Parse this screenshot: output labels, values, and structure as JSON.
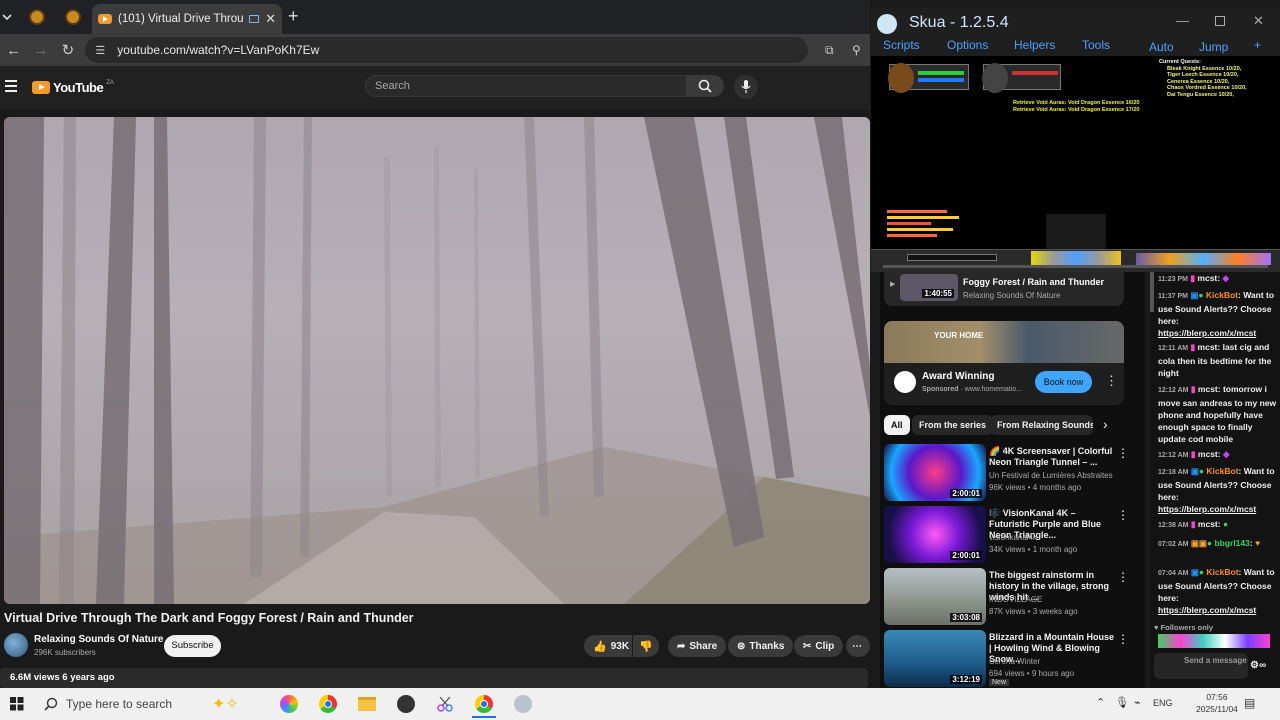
{
  "browser": {
    "tab_title": "(101) Virtual Drive Through",
    "url": "youtube.com/watch?v=LVanPoKh7Ew"
  },
  "youtube": {
    "logo": "YouTube",
    "region": "ZA",
    "search_placeholder": "Search",
    "video_title": "Virtual Drive Through The Dark and Foggy Forest / Rain and Thunder",
    "channel_name": "Relaxing Sounds Of Nature",
    "subscribers": "296K subscribers",
    "subscribe_label": "Subscribe",
    "likes": "93K",
    "share_label": "Share",
    "thanks_label": "Thanks",
    "clip_label": "Clip",
    "views_age": "6.6M views  6 years ago",
    "playlist_item": {
      "title": "Foggy Forest / Rain and Thunder",
      "channel": "Relaxing Sounds Of Nature",
      "duration": "1:40:55"
    },
    "ad": {
      "banner_line1": "YOUR HOME",
      "title": "Award Winning",
      "sponsor": "Sponsored",
      "url": "www.homematio...",
      "cta": "Book now"
    },
    "chips": [
      "All",
      "From the series",
      "From Relaxing Sounds Of"
    ],
    "recommendations": [
      {
        "title": "🌈 4K Screensaver | Colorful Neon Triangle Tunnel – ...",
        "channel": "Un Festival de Lumières Abstraites",
        "meta": "96K views • 4 months ago",
        "duration": "2:00:01"
      },
      {
        "title": "🎼 VisionKanal 4K – Futuristic Purple and Blue Neon Triangle...",
        "channel": "visionkanal4k",
        "meta": "34K views • 1 month ago",
        "duration": "2:00:01"
      },
      {
        "title": "The biggest rainstorm in history in the village, strong winds hit ...",
        "channel": "INDOVILLAGE",
        "meta": "87K views • 3 weeks ago",
        "duration": "3:03:08"
      },
      {
        "title": "Blizzard in a Mountain House | Howling Wind & Blowing Snow...",
        "channel": "Serena Winter",
        "meta": "694 views • 9 hours ago",
        "badge": "New",
        "duration": "3:12:19"
      }
    ]
  },
  "skua": {
    "title": "Skua - 1.2.5.4",
    "menu": [
      "Scripts",
      "Options",
      "Helpers",
      "Tools"
    ],
    "menu_right": [
      "Auto",
      "Jump",
      "+"
    ],
    "quests_header": "Current Quests:",
    "quests": [
      "Bleak Knight Essence 10/20,",
      "Tiger Leech Essence 10/20,",
      "Cenerea Essence 10/20,",
      "Chaos Vordred Essence 10/20,",
      "Dai Tengu Essence 10/20,"
    ],
    "log": [
      "Retrieve Void Auras: Void Dragon Essence 16/20",
      "Retrieve Void Auras: Void Dragon Essence 17/20"
    ]
  },
  "chat": [
    {
      "time": "11:23 PM",
      "user": "mcst",
      "text": ""
    },
    {
      "time": "11:37 PM",
      "user": "KickBot",
      "text": "Want to use Sound Alerts?? Choose here:",
      "link": "https://blerp.com/x/mcst"
    },
    {
      "time": "12:11 AM",
      "user": "mcst",
      "text": "last cig and cola then its bedtime for the night"
    },
    {
      "time": "12:12 AM",
      "user": "mcst",
      "text": "tomorrow i move san andreas to my new phone and hopefully have enough space to finally update cod mobile"
    },
    {
      "time": "12:12 AM",
      "user": "mcst",
      "text": ""
    },
    {
      "time": "12:18 AM",
      "user": "KickBot",
      "text": "Want to use Sound Alerts?? Choose here:",
      "link": "https://blerp.com/x/mcst"
    },
    {
      "time": "12:38 AM",
      "user": "mcst",
      "text": ""
    },
    {
      "time": "07:02 AM",
      "user": "bbgrl143",
      "text": ""
    },
    {
      "time": "07:04 AM",
      "user": "KickBot",
      "text": "Want to use Sound Alerts?? Choose here:",
      "link": "https://blerp.com/x/mcst"
    }
  ],
  "chat_footer": {
    "followers": "Followers only",
    "send_placeholder": "Send a message"
  },
  "taskbar": {
    "search": "Type here to search",
    "lang": "ENG",
    "time": "07:56",
    "date": "2025/11/04"
  },
  "colors": {
    "accent_blue": "#4aa3ff",
    "kickbot_orange": "#ff8c1a",
    "mcst_pink": "#ff3fd2"
  }
}
